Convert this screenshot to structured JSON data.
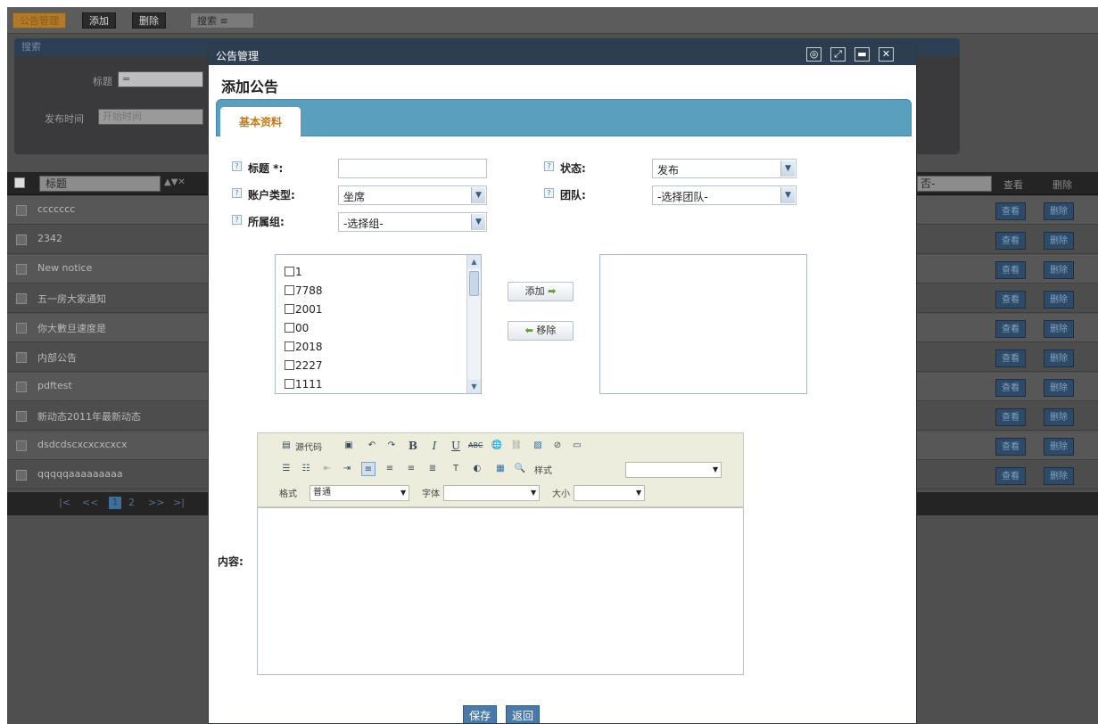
{
  "app": {
    "toolbar": {
      "active_label": "公告管理",
      "add_label": "添加",
      "delete_label": "删除",
      "search_label": "搜索"
    },
    "search_panel": {
      "title": "搜索",
      "title_label": "标题",
      "title_operator": "=",
      "publish_time_label": "发布时间",
      "start_time_placeholder": "开始时间"
    },
    "grid": {
      "title_column": "标题",
      "right_select": "否-",
      "view_column": "查看",
      "delete_column": "删除",
      "rows": [
        {
          "title": "ccccccc",
          "view": "查看",
          "delete": "删除"
        },
        {
          "title": "2342",
          "view": "查看",
          "delete": "删除"
        },
        {
          "title": "New notice",
          "view": "查看",
          "delete": "删除"
        },
        {
          "title": "五一房大家通知",
          "view": "查看",
          "delete": "删除"
        },
        {
          "title": "你大數旦速度是",
          "view": "查看",
          "delete": "删除"
        },
        {
          "title": "内部公告",
          "view": "查看",
          "delete": "删除"
        },
        {
          "title": "pdftest",
          "view": "查看",
          "delete": "删除"
        },
        {
          "title": "新动态2011年最新动态",
          "view": "查看",
          "delete": "删除"
        },
        {
          "title": "dsdcdscxcxcxcxcx",
          "view": "查看",
          "delete": "删除"
        },
        {
          "title": "qqqqqaaaaaaaaa",
          "view": "查看",
          "delete": "删除"
        }
      ]
    },
    "pager": {
      "first": "|<",
      "prev": "<<",
      "current": "1",
      "next_page": "2",
      "next": ">>",
      "last": ">|"
    }
  },
  "modal": {
    "title": "公告管理",
    "heading": "添加公告",
    "tab_basic": "基本资料",
    "form": {
      "title_label": "标题 *:",
      "title_value": "",
      "status_label": "状态:",
      "status_value": "发布",
      "account_type_label": "账户类型:",
      "account_type_value": "坐席",
      "team_label": "团队:",
      "team_value": "-选择团队-",
      "group_label": "所属组:",
      "group_value": "-选择组-"
    },
    "group_items": [
      "1",
      "7788",
      "2001",
      "00",
      "2018",
      "2227",
      "1111"
    ],
    "add_button": "添加",
    "remove_button": "移除",
    "editor": {
      "source_label": "源代码",
      "style_label": "样式",
      "style_value": "",
      "format_label": "格式",
      "format_value": "普通",
      "font_label": "字体",
      "font_value": "",
      "size_label": "大小",
      "size_value": ""
    },
    "content_label": "内容:",
    "save_button": "保存",
    "back_button": "返回"
  }
}
